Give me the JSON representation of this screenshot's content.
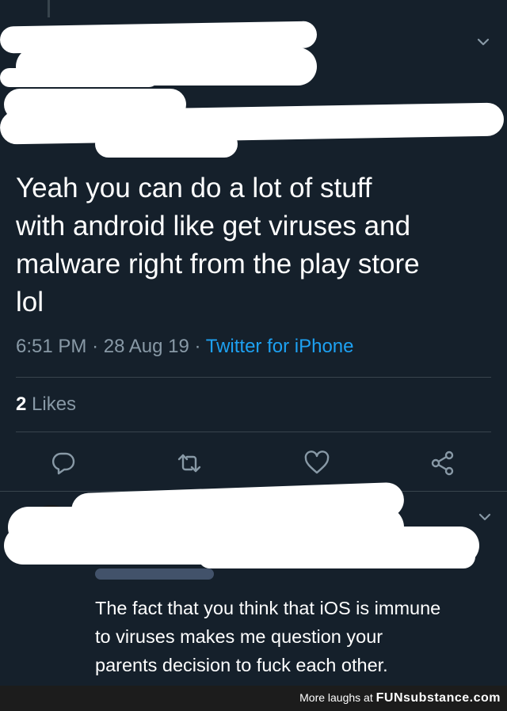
{
  "tweet": {
    "text": "Yeah you can do a lot of stuff\nwith android like get viruses and\nmalware right from the play store\nlol",
    "time": "6:51 PM",
    "date": "28 Aug 19",
    "source": "Twitter for iPhone",
    "likes_count": "2",
    "likes_label": "Likes"
  },
  "actions": {
    "icons": [
      "reply-icon",
      "retweet-icon",
      "like-icon",
      "share-icon"
    ]
  },
  "reply": {
    "text": "The fact that you think that iOS is immune\nto viruses makes me question your\nparents decision to fuck each other."
  },
  "footer": {
    "prefix": "More laughs at",
    "brand": "FUNsubstance.com"
  },
  "colors": {
    "background": "#15202b",
    "muted": "#8899a6",
    "link": "#1da1f2",
    "divider": "#38444d"
  }
}
